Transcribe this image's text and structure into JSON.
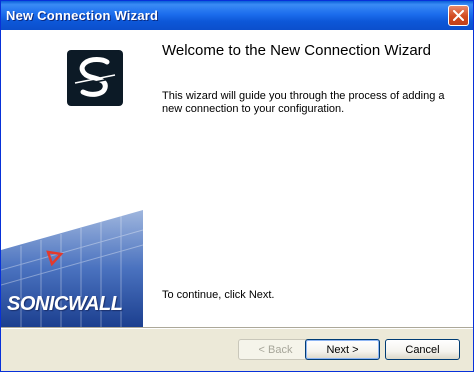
{
  "window": {
    "title": "New Connection Wizard",
    "close_icon": "close-icon"
  },
  "main": {
    "heading": "Welcome to the New Connection Wizard",
    "description": "This wizard will guide you through the process of adding a new connection to your configuration.",
    "continue_text": "To continue, click Next."
  },
  "side_panel": {
    "logo_icon": "sonicwall-s-logo-icon",
    "brand": "SONICWALL"
  },
  "footer": {
    "back_label": "< Back",
    "next_label": "Next >",
    "cancel_label": "Cancel"
  },
  "colors": {
    "titlebar": "#0b4fcc",
    "banner_blue": "#2f5fb0",
    "arrow_red": "#e23a2e"
  }
}
